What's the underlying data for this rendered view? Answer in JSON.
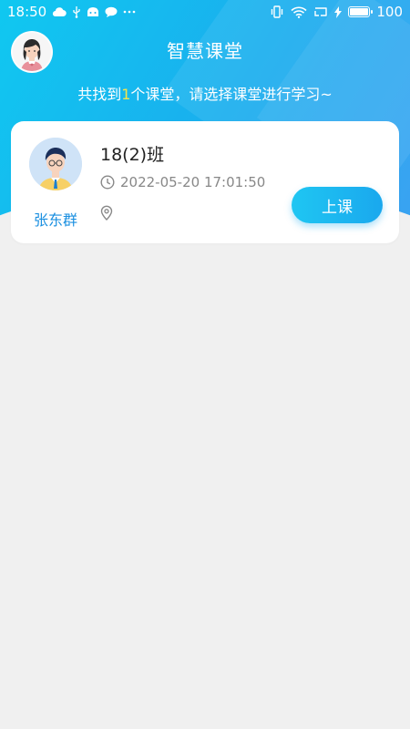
{
  "status_bar": {
    "time": "18:50",
    "battery_level": "100",
    "left_icons": [
      "cloud-icon",
      "usb-icon",
      "android-icon",
      "message-icon",
      "more-dots-icon"
    ],
    "right_icons": [
      "vibrate-icon",
      "wifi-icon",
      "screen-cast-icon",
      "charging-icon",
      "battery-icon"
    ]
  },
  "header": {
    "title": "智慧课堂",
    "subtitle_prefix": "共找到",
    "classroom_count": "1",
    "subtitle_suffix": "个课堂，请选择课堂进行学习~",
    "count_color": "#f6e44a",
    "accent_color": "#1aaeee"
  },
  "classrooms": [
    {
      "teacher_name": "张东群",
      "class_name": "18(2)班",
      "time": "2022-05-20 17:01:50",
      "location": "",
      "action_label": "上课"
    }
  ]
}
